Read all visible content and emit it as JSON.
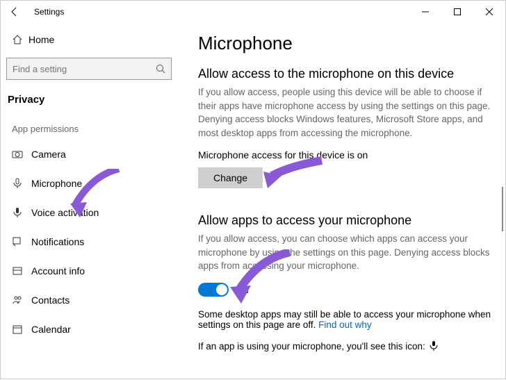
{
  "titlebar": {
    "title": "Settings"
  },
  "sidebar": {
    "home": "Home",
    "search_placeholder": "Find a setting",
    "section": "Privacy",
    "group": "App permissions",
    "items": [
      {
        "label": "Camera"
      },
      {
        "label": "Microphone"
      },
      {
        "label": "Voice activation"
      },
      {
        "label": "Notifications"
      },
      {
        "label": "Account info"
      },
      {
        "label": "Contacts"
      },
      {
        "label": "Calendar"
      }
    ]
  },
  "main": {
    "title": "Microphone",
    "sec1_heading": "Allow access to the microphone on this device",
    "sec1_desc": "If you allow access, people using this device will be able to choose if their apps have microphone access by using the settings on this page. Denying access blocks Windows features, Microsoft Store apps, and most desktop apps from accessing the microphone.",
    "device_status": "Microphone access for this device is on",
    "change_label": "Change",
    "sec2_heading": "Allow apps to access your microphone",
    "sec2_desc": "If you allow access, you can choose which apps can access your microphone by using the settings on this page. Denying access blocks apps from accessing your microphone.",
    "toggle_state": "On",
    "note_text": "Some desktop apps may still be able to access your microphone when settings on this page are off.",
    "note_link": "Find out why",
    "using_text": "If an app is using your microphone, you'll see this icon:"
  }
}
